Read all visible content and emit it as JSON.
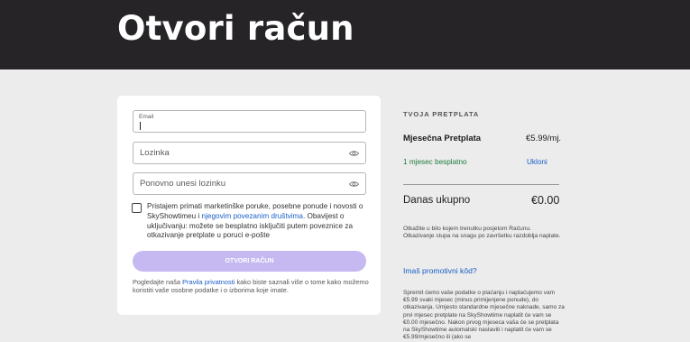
{
  "page": {
    "title": "Otvori račun"
  },
  "form": {
    "email_label": "Email",
    "password_placeholder": "Lozinka",
    "confirm_placeholder": "Ponovno unesi lozinku",
    "consent_text_1": "Pristajem primati marketinške poruke, posebne ponude i novosti o SkyShowtimeu i ",
    "consent_link": "njegovim povezanim društvima",
    "consent_text_2": ". Obavijest o uključivanju: možete se besplatno isključiti putem poveznice za otkazivanje pretplate u poruci e-pošte",
    "submit_label": "OTVORI RAČUN",
    "privacy_text_1": "Pogledajte naša ",
    "privacy_link": "Pravila privatnosti",
    "privacy_text_2": " kako biste saznali više o tome kako možemo koristiti vaše osobne podatke i o izborima koje imate."
  },
  "subscription": {
    "title": "TVOJA PRETPLATA",
    "plan_name": "Mjesečna Pretplata",
    "plan_price": "€5.99/mj.",
    "free_offer": "1 mjesec besplatno",
    "remove_label": "Ukloni",
    "total_label": "Danas ukupno",
    "total_value": "€0.00",
    "cancel_note": "Otkažite u bilo kojem trenutku posjetom Računu. Otkazivanje stupa na snagu po završetku razdoblja naplate.",
    "promo_link": "Imaš promotivni kôd?",
    "legal_text": "Spremit ćemo vaše podatke o plaćanju i naplaćujemo vam €5.99 svaki mjesec (minus primijenjene ponude), do otkazivanja. Umjesto standardne mjesečne naknade, samo za prvi mjesec pretplate na SkyShowtime naplatit će vam se €0.00 mjesečno. Nakon prvog mjeseca vaša će se pretplata na SkyShowtime automatski nastaviti i naplatit će vam se €5.99/mjesečno ili (ako se"
  },
  "colors": {
    "header_bg": "#262427",
    "page_bg": "#ececec",
    "link": "#1a5ec7",
    "offer_green": "#1f7a3a",
    "button_disabled": "#c6b9f2"
  },
  "icons": {
    "password_toggle": "eye-icon"
  }
}
